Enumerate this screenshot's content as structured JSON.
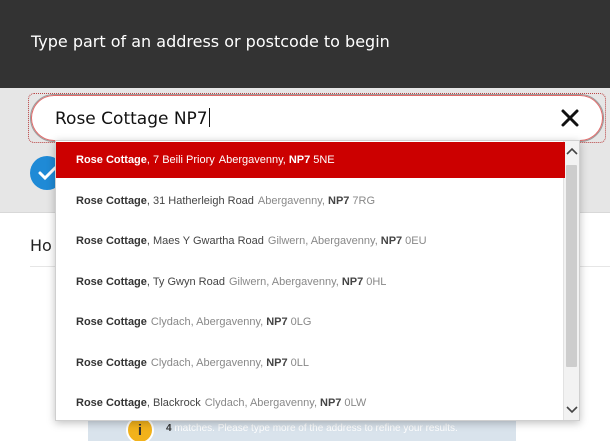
{
  "header": {
    "title": "Type part of an address or postcode to begin"
  },
  "search": {
    "value": "Rose Cottage NP7"
  },
  "section": {
    "heading": "Ho"
  },
  "results": [
    {
      "name": "Rose Cottage",
      "street": ", 7 Beili Priory",
      "town": "Abergavenny,",
      "pc": "NP7",
      "pc_rest": "5NE",
      "selected": true
    },
    {
      "name": "Rose Cottage",
      "street": ", 31 Hatherleigh Road",
      "town": "Abergavenny,",
      "pc": "NP7",
      "pc_rest": "7RG",
      "selected": false
    },
    {
      "name": "Rose Cottage",
      "street": ", Maes Y Gwartha Road",
      "town": "Gilwern, Abergavenny,",
      "pc": "NP7",
      "pc_rest": "0EU",
      "selected": false
    },
    {
      "name": "Rose Cottage",
      "street": ", Ty Gwyn Road",
      "town": "Gilwern, Abergavenny,",
      "pc": "NP7",
      "pc_rest": "0HL",
      "selected": false
    },
    {
      "name": "Rose Cottage",
      "street": "",
      "town": "Clydach, Abergavenny,",
      "pc": "NP7",
      "pc_rest": "0LG",
      "selected": false
    },
    {
      "name": "Rose Cottage",
      "street": "",
      "town": "Clydach, Abergavenny,",
      "pc": "NP7",
      "pc_rest": "0LL",
      "selected": false
    },
    {
      "name": "Rose Cottage",
      "street": ", Blackrock",
      "town": "Clydach, Abergavenny,",
      "pc": "NP7",
      "pc_rest": "0LW",
      "selected": false
    }
  ],
  "matches": {
    "count": "4",
    "text": "matches. Please type more of the address to refine your results."
  },
  "colors": {
    "header_bg": "#333333",
    "selected_bg": "#cc0000",
    "check_badge": "#1f8ad6",
    "info_badge": "#f2b21b"
  },
  "icons": {
    "clear": "close-icon",
    "check": "check-icon",
    "info": "info-icon",
    "scroll_up": "chevron-up-icon",
    "scroll_down": "chevron-down-icon"
  }
}
